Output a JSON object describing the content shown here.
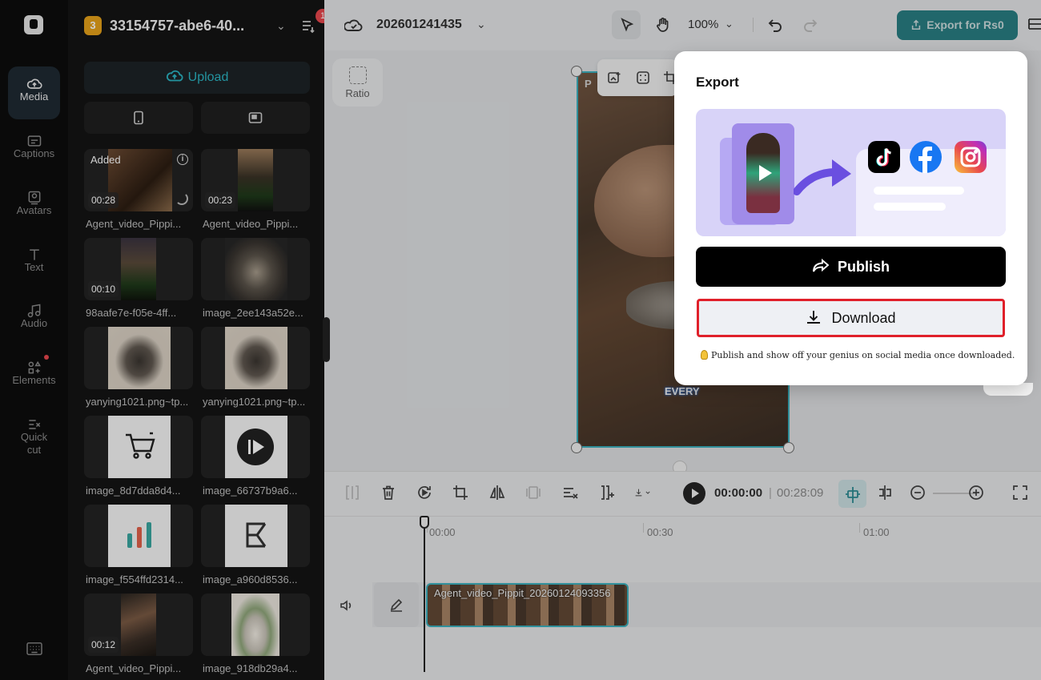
{
  "rail": {
    "items": [
      {
        "label": "Media",
        "icon": "cloud-upload-icon",
        "active": true
      },
      {
        "label": "Captions",
        "icon": "captions-icon"
      },
      {
        "label": "Avatars",
        "icon": "avatar-icon"
      },
      {
        "label": "Text",
        "icon": "text-icon"
      },
      {
        "label": "Audio",
        "icon": "music-note-icon"
      },
      {
        "label": "Elements",
        "icon": "elements-icon",
        "has_dot": true
      },
      {
        "label": "Quick",
        "label2": "cut",
        "icon": "quick-cut-icon"
      }
    ]
  },
  "media": {
    "project_badge": "3",
    "project_name": "33154757-abe6-40...",
    "notification_count": "1",
    "upload_label": "Upload",
    "tiles": [
      {
        "label": "Agent_video_Pippi...",
        "duration": "00:28",
        "added": "Added",
        "loading": true
      },
      {
        "label": "Agent_video_Pippi...",
        "duration": "00:23"
      },
      {
        "label": "98aafe7e-f05e-4ff...",
        "duration": "00:10"
      },
      {
        "label": "image_2ee143a52e..."
      },
      {
        "label": "yanying1021.png~tp..."
      },
      {
        "label": "yanying1021.png~tp..."
      },
      {
        "label": "image_8d7dda8d4..."
      },
      {
        "label": "image_66737b9a6..."
      },
      {
        "label": "image_f554ffd2314..."
      },
      {
        "label": "image_a960d8536..."
      },
      {
        "label": "Agent_video_Pippi...",
        "duration": "00:12"
      },
      {
        "label": "image_918db29a4..."
      }
    ]
  },
  "topbar": {
    "file_name": "202601241435",
    "zoom": "100%",
    "export_label": "Export for Rs0"
  },
  "canvas": {
    "ratio_label": "Ratio",
    "video_caption": "EVERY",
    "video_top_text": "P"
  },
  "timeline": {
    "current_time": "00:00:00",
    "separator": "|",
    "total_time": "00:28:09",
    "ruler": [
      "00:00",
      "00:30",
      "01:00"
    ],
    "clip_label": "Agent_video_Pippit_20260124093356"
  },
  "export_modal": {
    "title": "Export",
    "publish_label": "Publish",
    "download_label": "Download",
    "hint": "Publish and show off your genius on social media once downloaded."
  }
}
